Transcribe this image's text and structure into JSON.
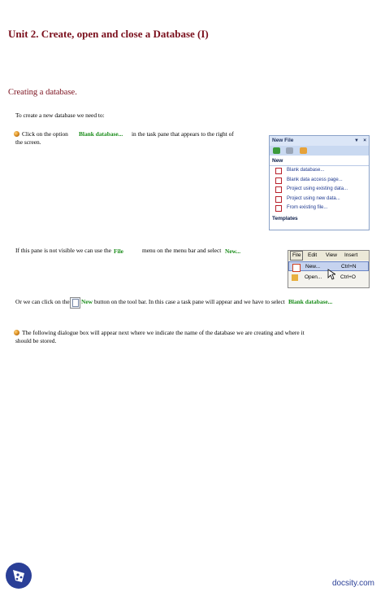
{
  "heading": "Unit 2. Create, open and close a Database (I)",
  "subheading": "Creating a database.",
  "intro": "To create a new database we need to:",
  "step1": {
    "before": "Click on the option",
    "highlight": "Blank database...",
    "after_line1": "in the task pane that appears to the right of",
    "after_line2": "the screen."
  },
  "step2": {
    "before": "If this pane is not visible we can use the",
    "file": "File",
    "middle": "menu on the menu bar and select",
    "new": "New..."
  },
  "step3": {
    "before": "Or we can click on the",
    "new": "New",
    "middle": "button on the tool bar. In this case a task pane will appear and we have to select",
    "highlight": "Blank database..."
  },
  "step4": {
    "line1": "The following dialogue box will appear next where we indicate the name of the database we are creating and where it",
    "line2": "should be stored."
  },
  "task_pane": {
    "title": "New File",
    "section_new": "New",
    "items": [
      "Blank database...",
      "Blank data access page...",
      "Project using existing data...",
      "Project using new data...",
      "From existing file..."
    ],
    "section_templates": "Templates"
  },
  "file_menu": {
    "bar": [
      "File",
      "Edit",
      "View",
      "Insert"
    ],
    "items": [
      {
        "label": "New...",
        "shortcut": "Ctrl+N"
      },
      {
        "label": "Open...",
        "shortcut": "Ctrl+O"
      }
    ]
  },
  "footer": {
    "brand": "docsity.com"
  },
  "colors": {
    "heading": "#7a0f1c",
    "highlight": "#1a8c1a",
    "link": "#1f3a90",
    "brand": "#2a3f97"
  }
}
